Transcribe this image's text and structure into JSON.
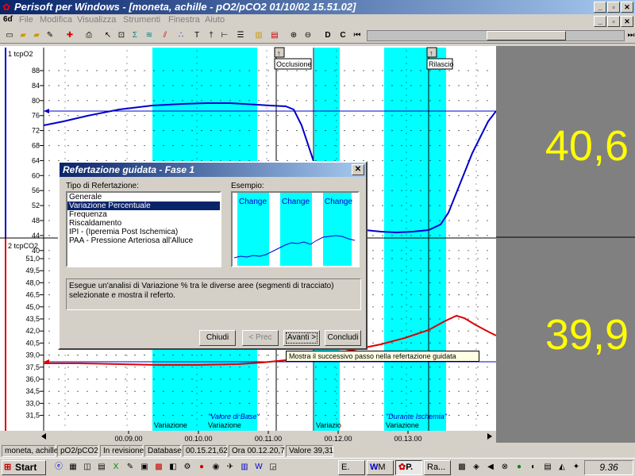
{
  "window": {
    "title": "Perisoft per Windows - [moneta, achille - pO2/pCO2 01/10/02 15.51.02]"
  },
  "menu": [
    "File",
    "Modifica",
    "Visualizza",
    "Strumenti",
    "Finestra",
    "Aiuto"
  ],
  "toolbar": {
    "btn_d": "D",
    "btn_c": "C"
  },
  "chart": {
    "top_label": "1 tcpO2",
    "bottom_label": "2 tcpCO2",
    "top_ticks": [
      "88",
      "84",
      "80",
      "76",
      "72",
      "68",
      "64",
      "60",
      "56",
      "52",
      "48",
      "44",
      "40"
    ],
    "bottom_ticks": [
      "51,0",
      "49,5",
      "48,0",
      "46,5",
      "45,0",
      "43,5",
      "42,0",
      "40,5",
      "39,0",
      "37,5",
      "36,0",
      "34,5",
      "33,0",
      "31,5"
    ],
    "x_ticks": [
      "00.09.00",
      "00.10.00",
      "00.11.00",
      "00.12.00",
      "00.13.00"
    ],
    "marker_occlusione": "Occlusione",
    "marker_rilascio": "Rilascio",
    "segment_labels": [
      "Variazione",
      "Variazione",
      "Variazio",
      "Variazione"
    ],
    "segment_quotes": [
      "\"Valore di Base\"",
      "\"Durante Ischemia\""
    ],
    "accent_cyan": "#00ffff",
    "po2_color": "#0000cc",
    "pco2_color": "#dd0000"
  },
  "readout": {
    "top_value": "40,6",
    "bottom_value": "39,9"
  },
  "dialog": {
    "title": "Refertazione guidata - Fase 1",
    "type_label": "Tipo di Refertazione:",
    "example_label": "Esempio:",
    "items": [
      "Generale",
      "Variazione Percentuale",
      "Frequenza",
      "Riscaldamento",
      "IPI - (Iperemia Post Ischemica)",
      "PAA - Pressione Arteriosa all'Alluce"
    ],
    "example_change": "Change",
    "description": "Esegue un'analisi di Variazione % tra le diverse aree (segmenti di tracciato) selezionate e mostra il referto.",
    "btn_close": "Chiudi",
    "btn_prev": "< Prec",
    "btn_next": "Avanti >",
    "btn_finish": "Concludi"
  },
  "tooltip": "Mostra il successivo passo nella refertazione guidata",
  "status": [
    "moneta, achille",
    "pO2/pCO2",
    "In revisione",
    "Database",
    "00.15.21,62",
    "Ora 00.12.20,7",
    "Valore 39,31"
  ],
  "taskbar": {
    "start": "Start",
    "task1": "E.",
    "task2": "M",
    "task3": "P.",
    "task4": "Ra...",
    "clock": "9.36"
  }
}
